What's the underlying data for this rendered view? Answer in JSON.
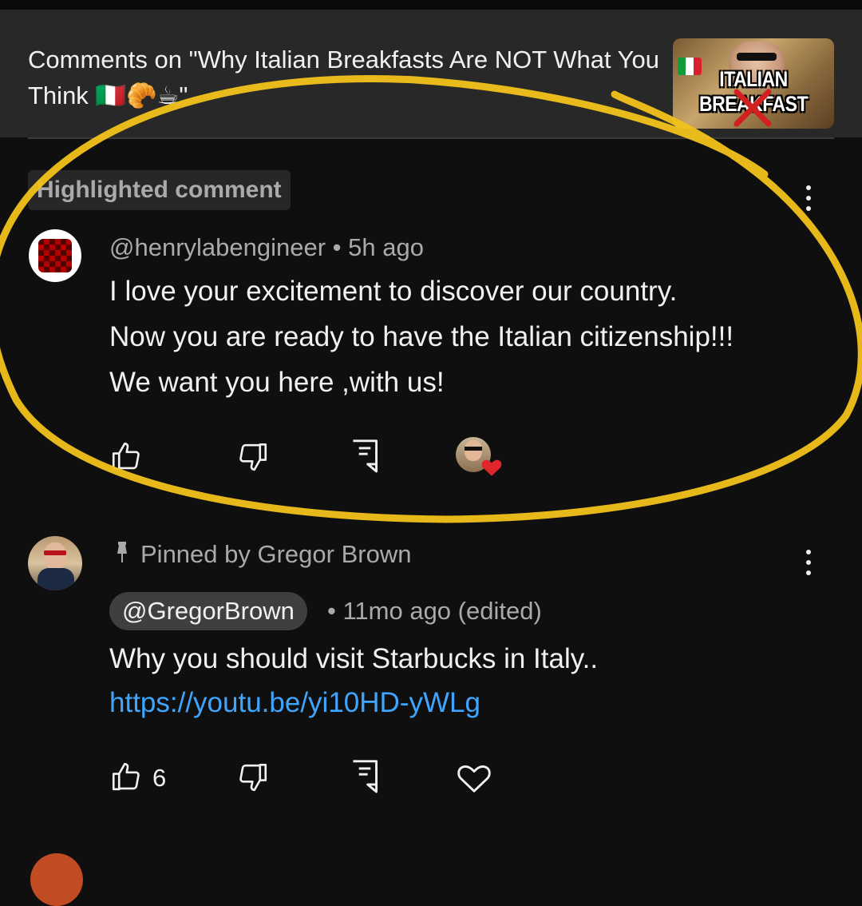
{
  "header": {
    "title": "Comments on \"Why Italian Breakfasts Are NOT What You Think 🇮🇹🥐☕\"",
    "thumbnail_text": "ITALIAN BREAKFAST"
  },
  "highlighted_chip": "Highlighted comment",
  "comments": [
    {
      "author": "@henrylabengineer",
      "time": "• 5h ago",
      "lines": [
        "I love your excitement to discover our country.",
        "Now you are ready to have the Italian citizenship!!!",
        "We want you here ,with us!"
      ],
      "likes": "",
      "creator_hearted": true
    },
    {
      "pinned_label": "Pinned by Gregor Brown",
      "author": "@GregorBrown",
      "time": "• 11mo ago (edited)",
      "text": "Why you should visit Starbucks in Italy..",
      "link": "https://youtu.be/yi10HD-yWLg",
      "likes": "6",
      "creator_hearted": false
    }
  ],
  "colors": {
    "background": "#0f0f0f",
    "header": "#282828",
    "link": "#3ea6ff",
    "annotation": "#f2c21b",
    "heart": "#e0262b"
  },
  "icons": [
    "like-icon",
    "dislike-icon",
    "reply-icon",
    "heart-icon",
    "more-vert-icon",
    "pin-icon"
  ]
}
